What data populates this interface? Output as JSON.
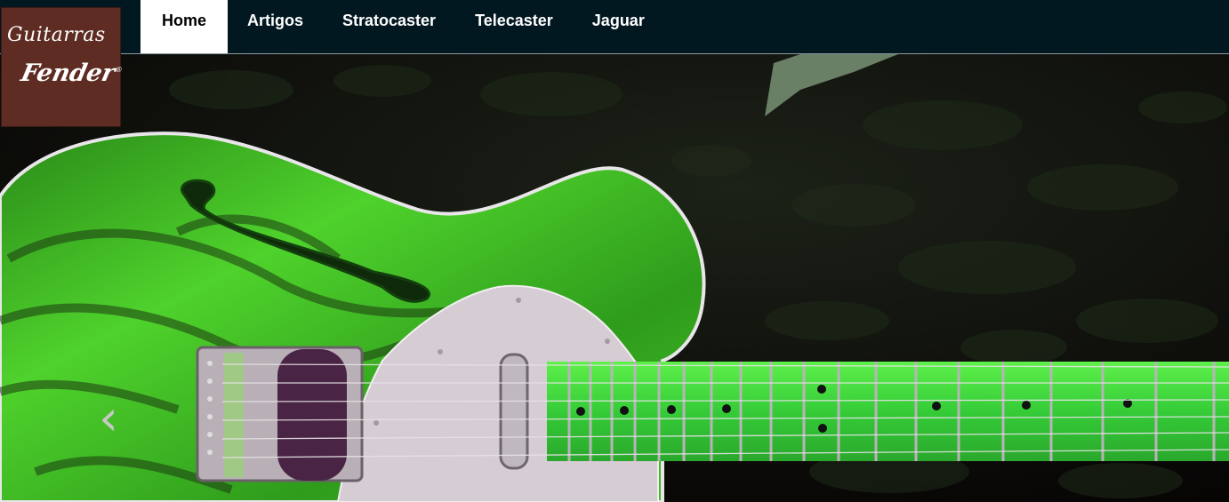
{
  "logo": {
    "line1": "Guitarras",
    "line2": "Fender",
    "mark": "®"
  },
  "nav": {
    "items": [
      {
        "label": "Home",
        "active": true
      },
      {
        "label": "Artigos",
        "active": false
      },
      {
        "label": "Stratocaster",
        "active": false
      },
      {
        "label": "Telecaster",
        "active": false
      },
      {
        "label": "Jaguar",
        "active": false
      }
    ]
  },
  "carousel": {
    "prev_icon": "chevron-left-icon"
  },
  "colors": {
    "nav_bg": "#021820",
    "logo_bg": "#5e2c22",
    "guitar_body": "#3fc624",
    "fretboard": "#39d13a",
    "pickguard": "#d6ccd4"
  }
}
